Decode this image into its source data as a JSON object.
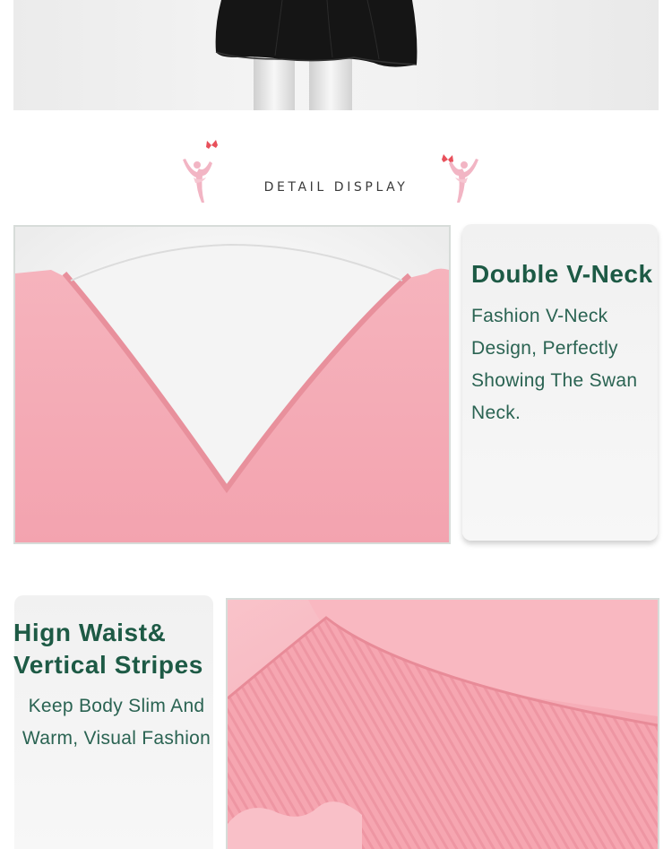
{
  "section": {
    "title": "DETAIL DISPLAY"
  },
  "features": [
    {
      "heading": "Double V-Neck",
      "description": "Fashion V-Neck Design, Perfectly Showing The Swan Neck."
    },
    {
      "heading_line1": "Hign Waist&",
      "heading_line2": "Vertical Stripes",
      "description_line1": "Keep Body Slim And",
      "description_line2": "Warm, Visual Fashion"
    }
  ],
  "colors": {
    "accent_green": "#1d5a45",
    "text_green": "#2a6352",
    "garment_pink": "#f6a6b1",
    "ornament_pink": "#f2b5c4",
    "butterfly_red": "#e8505b"
  },
  "icons": [
    "ballerina-icon",
    "butterfly-icon"
  ]
}
